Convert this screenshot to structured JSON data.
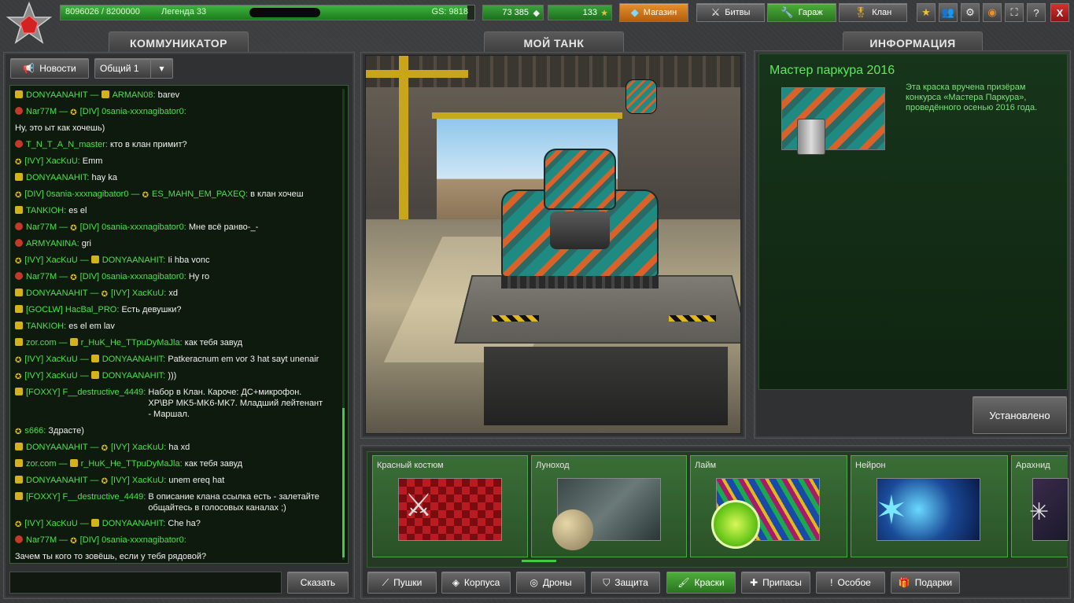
{
  "topbar": {
    "xp_text": "8096026 / 8200000",
    "rank_name": "Легенда 33",
    "gs_text": "GS: 9818",
    "xp_progress": 0.987,
    "crystals": "73 385",
    "stars": "133",
    "shop_label": "Магазин",
    "battles_label": "Битвы",
    "garage_label": "Гараж",
    "clan_label": "Клан",
    "close_label": "X"
  },
  "headers": {
    "communicator": "КОММУНИКАТОР",
    "my_tank": "МОЙ ТАНК",
    "info": "ИНФОРМАЦИЯ"
  },
  "chat": {
    "news_label": "Новости",
    "channel_value": "Общий 1",
    "send_label": "Сказать",
    "messages": [
      {
        "from": "DONYAANAHIT —",
        "to": "ARMAN08:",
        "text": "barev",
        "a": "y",
        "b": "y"
      },
      {
        "from": "Nar77M —",
        "to": "[DIV] 0sania-xxxnagibator0:",
        "text": "",
        "a": "red",
        "b": "star"
      },
      {
        "from": "",
        "to": "",
        "text": "Ну, это ыт как хочешь)",
        "a": "",
        "b": ""
      },
      {
        "from": "T_N_T_A_N_master:",
        "to": "",
        "text": "кто в клан примит?",
        "a": "red",
        "b": ""
      },
      {
        "from": "[IVY] XacKuU:",
        "to": "",
        "text": "Emm",
        "a": "star",
        "b": ""
      },
      {
        "from": "DONYAANAHIT:",
        "to": "",
        "text": "hay ka",
        "a": "y",
        "b": ""
      },
      {
        "from": "[DIV] 0sania-xxxnagibator0 —",
        "to": "ES_MAHN_EM_PAXEQ:",
        "text": "в клан хочеш",
        "a": "star",
        "b": "star"
      },
      {
        "from": "TANKIOH:",
        "to": "",
        "text": "es el",
        "a": "y",
        "b": ""
      },
      {
        "from": "Nar77M —",
        "to": "[DIV] 0sania-xxxnagibator0:",
        "text": "Мне всё ранво-_-",
        "a": "red",
        "b": "star"
      },
      {
        "from": "ARMYANINA:",
        "to": "",
        "text": "gri",
        "a": "red",
        "b": ""
      },
      {
        "from": "[IVY] XacKuU —",
        "to": "DONYAANAHIT:",
        "text": "Ii hba vonc",
        "a": "star",
        "b": "y"
      },
      {
        "from": "Nar77M —",
        "to": "[DIV] 0sania-xxxnagibator0:",
        "text": "Hy ro",
        "a": "red",
        "b": "star"
      },
      {
        "from": "DONYAANAHIT —",
        "to": "[IVY] XacKuU:",
        "text": "xd",
        "a": "y",
        "b": "star"
      },
      {
        "from": "[GOCLW] HacBal_PRO:",
        "to": "",
        "text": "Есть девушки?",
        "a": "y",
        "b": ""
      },
      {
        "from": "TANKIOH:",
        "to": "",
        "text": "es el em lav",
        "a": "y",
        "b": ""
      },
      {
        "from": "zor.com —",
        "to": "r_HuK_He_TTpuDyMaJla:",
        "text": "как тебя завуд",
        "a": "y",
        "b": "y"
      },
      {
        "from": "[IVY] XacKuU —",
        "to": "DONYAANAHIT:",
        "text": "Patkeracnum em vor 3 hat sayt unenair",
        "a": "star",
        "b": "y"
      },
      {
        "from": "[IVY] XacKuU —",
        "to": "DONYAANAHIT:",
        "text": ")))",
        "a": "star",
        "b": "y"
      },
      {
        "from": "[FOXXY] F__destructive_4449:",
        "to": "",
        "text": "Набор в Клан. Кароче: ДС+микрофон. XP\\BP MK5-MK6-MK7. Младший лейтенант - Маршал.",
        "a": "y",
        "b": ""
      },
      {
        "from": "s666:",
        "to": "",
        "text": "Здрасте)",
        "a": "star",
        "b": ""
      },
      {
        "from": "DONYAANAHIT —",
        "to": "[IVY] XacKuU:",
        "text": "ha xd",
        "a": "y",
        "b": "star"
      },
      {
        "from": "zor.com —",
        "to": "r_HuK_He_TTpuDyMaJla:",
        "text": "как тебя завуд",
        "a": "y",
        "b": "y"
      },
      {
        "from": "DONYAANAHIT —",
        "to": "[IVY] XacKuU:",
        "text": "unem ereq hat",
        "a": "y",
        "b": "star"
      },
      {
        "from": "[FOXXY] F__destructive_4449:",
        "to": "",
        "text": "В описание клана ссылка есть - залетайте общайтесь в голосовых каналах ;)",
        "a": "y",
        "b": ""
      },
      {
        "from": "[IVY] XacKuU —",
        "to": "DONYAANAHIT:",
        "text": "Che ha?",
        "a": "star",
        "b": "y"
      },
      {
        "from": "Nar77M —",
        "to": "[DIV] 0sania-xxxnagibator0:",
        "text": "",
        "a": "red",
        "b": "star"
      },
      {
        "from": "",
        "to": "",
        "text": "Зачем ты кого то зовёшь, если у тебя рядовой?",
        "a": "",
        "b": ""
      }
    ]
  },
  "info": {
    "title": "Мастер паркура 2016",
    "description": "Эта краска вручена призёрам конкурса «Мастера Паркура», проведённого осенью 2016 года.",
    "status_label": "Установлено"
  },
  "paints": [
    {
      "name": "Красный костюм"
    },
    {
      "name": "Луноход"
    },
    {
      "name": "Лайм"
    },
    {
      "name": "Нейрон"
    },
    {
      "name": "Арахнид"
    }
  ],
  "categories": [
    {
      "label": "Пушки",
      "icon": "gun-icon"
    },
    {
      "label": "Корпуса",
      "icon": "hull-icon"
    },
    {
      "label": "Дроны",
      "icon": "drone-icon"
    },
    {
      "label": "Защита",
      "icon": "shield-icon"
    },
    {
      "label": "Краски",
      "icon": "paint-icon",
      "active": true
    },
    {
      "label": "Припасы",
      "icon": "supplies-icon"
    },
    {
      "label": "Особое",
      "icon": "special-icon"
    },
    {
      "label": "Подарки",
      "icon": "gift-icon"
    }
  ],
  "colors": {
    "accent_green": "#3cb53c",
    "name_green": "#4ee04e",
    "shop_orange": "#e8902a"
  }
}
